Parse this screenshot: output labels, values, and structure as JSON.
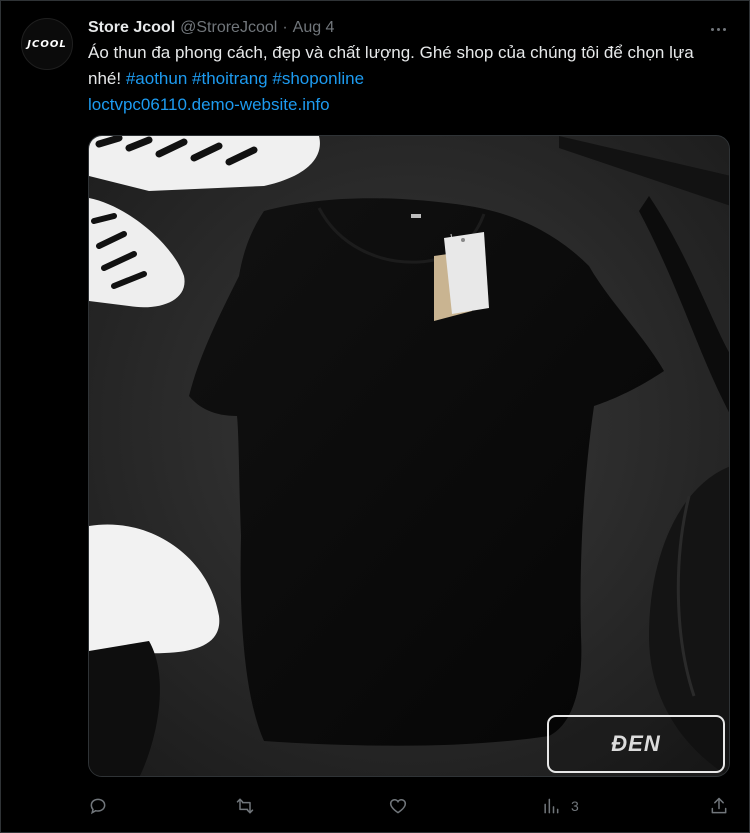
{
  "author": {
    "name": "Store Jcool",
    "handle": "@StroreJcool",
    "separator": "·",
    "date": "Aug 4",
    "avatar_text": "JCOOL"
  },
  "tweet": {
    "text_main": "Áo thun đa phong cách, đẹp và chất lượng. Ghé shop của chúng tôi để chọn lựa nhé!",
    "hashtags": [
      "#aothun",
      "#thoitrang",
      "#shoponline"
    ],
    "link": "loctvpc06110.demo-website.info"
  },
  "media": {
    "variant_label": "ĐEN",
    "description_icon": "black-tshirt-photo"
  },
  "actions": {
    "reply_icon": "reply-icon",
    "retweet_icon": "retweet-icon",
    "like_icon": "heart-icon",
    "views_icon": "analytics-icon",
    "views_count": "3",
    "share_icon": "share-icon"
  },
  "colors": {
    "background": "#000000",
    "text": "#e7e9ea",
    "muted": "#71767b",
    "link": "#1d9bf0",
    "border": "#2f3336"
  }
}
